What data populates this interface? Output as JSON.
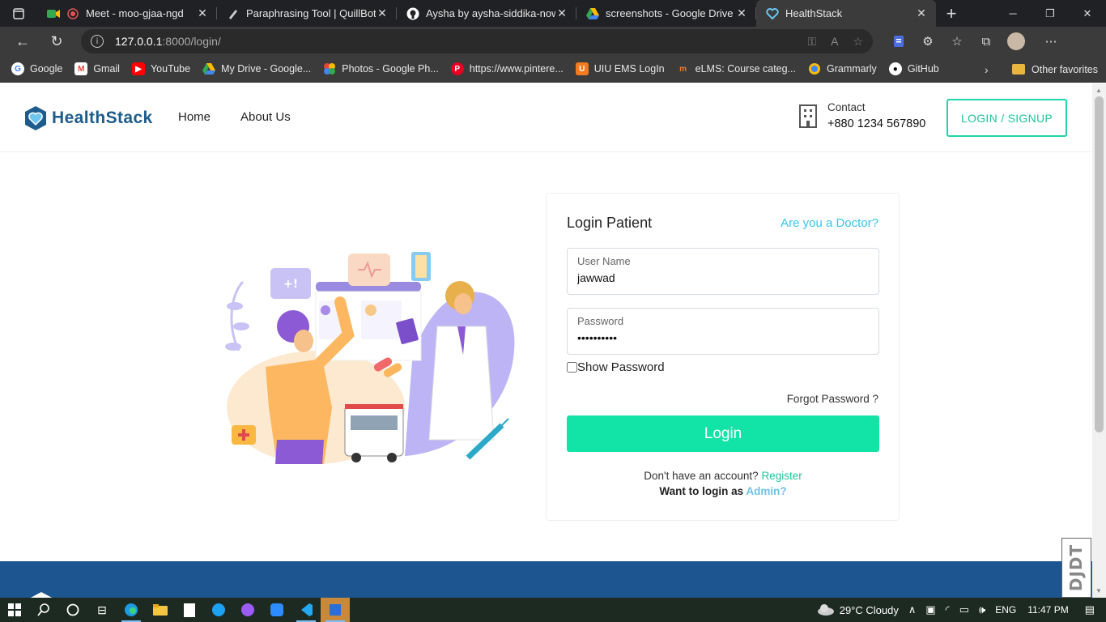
{
  "browser": {
    "tabs": [
      {
        "title": "Meet - moo-gjaa-ngd",
        "active": false
      },
      {
        "title": "Paraphrasing Tool | QuillBot AI",
        "active": false
      },
      {
        "title": "Aysha by aysha-siddika-nowshin",
        "active": false
      },
      {
        "title": "screenshots - Google Drive",
        "active": false
      },
      {
        "title": "HealthStack",
        "active": true
      }
    ],
    "url_host": "127.0.0.1",
    "url_path": ":8000/login/",
    "bookmarks": [
      "Google",
      "Gmail",
      "YouTube",
      "My Drive - Google...",
      "Photos - Google Ph...",
      "https://www.pintere...",
      "UIU EMS LogIn",
      "eLMS: Course categ...",
      "Grammarly",
      "GitHub"
    ],
    "other_favorites": "Other favorites"
  },
  "site": {
    "logo": "HealthStack",
    "nav": [
      "Home",
      "About Us"
    ],
    "contact_label": "Contact",
    "contact_phone": "+880 1234 567890",
    "login_signup": "LOGIN / SIGNUP"
  },
  "login": {
    "title": "Login Patient",
    "doctor_link": "Are you a Doctor?",
    "username_label": "User Name",
    "username_value": "jawwad",
    "password_label": "Password",
    "password_value": "••••••••••",
    "show_password": "Show Password",
    "forgot": "Forgot Password ?",
    "submit": "Login",
    "register_prompt": "Don't have an account?",
    "register_link": "Register",
    "admin_prompt": "Want to login as",
    "admin_link": "Admin?"
  },
  "watermark": "DJDT",
  "taskbar": {
    "weather": "29°C  Cloudy",
    "lang": "ENG",
    "time": "11:47 PM"
  },
  "colors": {
    "accent": "#12e3a7",
    "brand": "#1d5c8c",
    "link": "#33c6f0",
    "footer": "#1d5590"
  }
}
